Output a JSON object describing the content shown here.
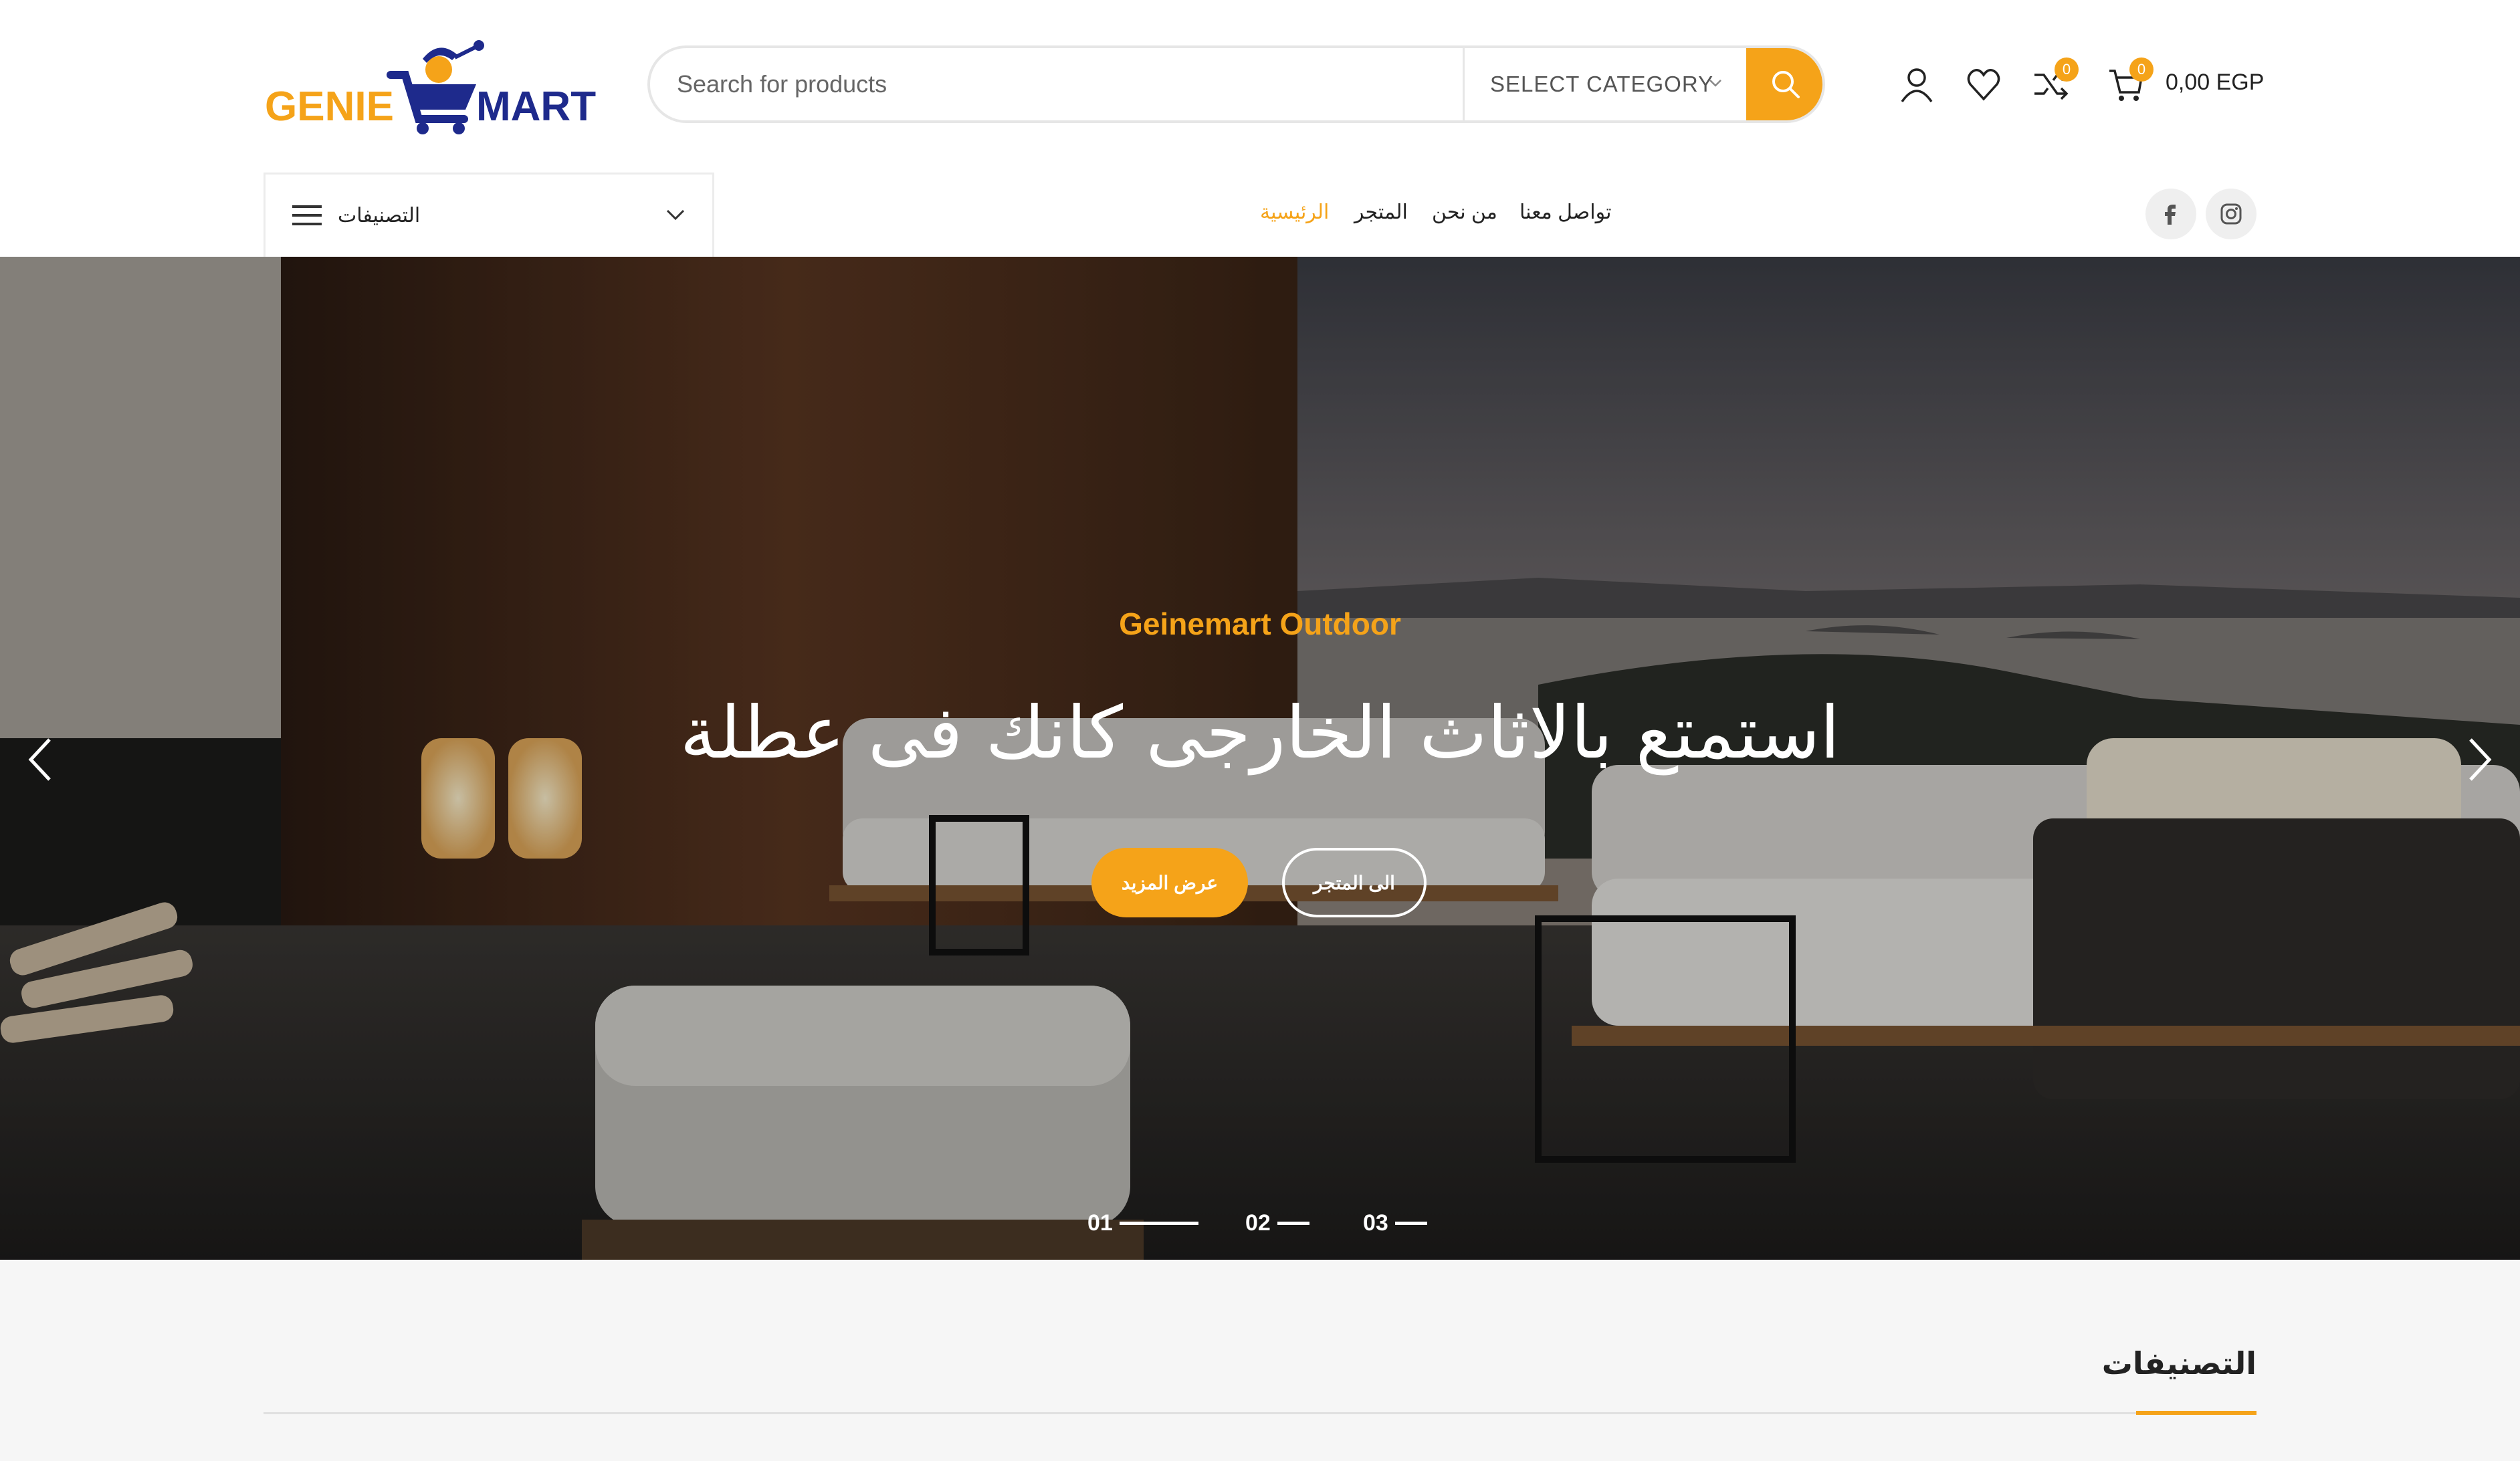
{
  "brand": {
    "logo_left": "GENIE",
    "logo_right": "MART",
    "accent": "#f5a319",
    "navy": "#1e2a8c"
  },
  "search": {
    "placeholder": "Search for products",
    "category_label": "SELECT CATEGORY",
    "button_icon": "search-icon"
  },
  "header_icons": {
    "account": "user-icon",
    "wishlist": "heart-icon",
    "compare": "compare-icon",
    "compare_count": "0",
    "cart": "cart-icon",
    "cart_count": "0",
    "cart_total": "0,00 EGP"
  },
  "categories_menu": {
    "label": "التصنيفات"
  },
  "nav": [
    {
      "label": "الرئيسية",
      "active": true
    },
    {
      "label": "المتجر"
    },
    {
      "label": "من نحن"
    },
    {
      "label": "تواصل معنا"
    }
  ],
  "social": [
    "facebook-icon",
    "instagram-icon"
  ],
  "hero": {
    "subtitle": "Geinemart Outdoor",
    "title": "استمتع بالاثاث الخارجى كانك فى عطلة",
    "primary_button": "عرض المزيد",
    "secondary_button": "الى المتجر",
    "slides": [
      "01",
      "02",
      "03"
    ],
    "active_slide": 1
  },
  "section": {
    "title": "التصنيفات"
  }
}
